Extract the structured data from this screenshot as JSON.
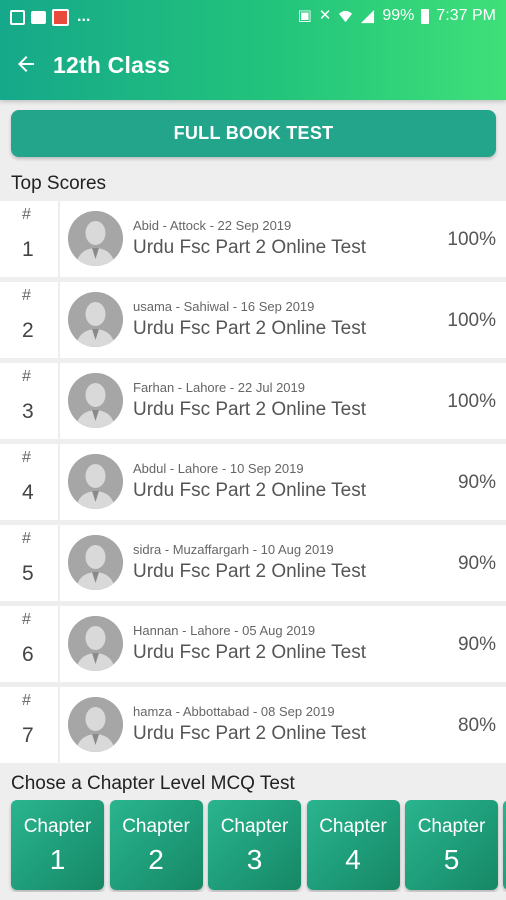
{
  "status_bar": {
    "battery": "99%",
    "time": "7:37 PM",
    "overflow": "..."
  },
  "app_bar": {
    "title": "12th Class"
  },
  "full_book_test": {
    "label": "FULL BOOK TEST"
  },
  "top_scores": {
    "title": "Top Scores",
    "hash": "#",
    "rows": [
      {
        "rank": "1",
        "meta": "Abid - Attock - 22 Sep 2019",
        "test": "Urdu Fsc Part 2 Online Test",
        "score": "100%"
      },
      {
        "rank": "2",
        "meta": "usama - Sahiwal - 16 Sep 2019",
        "test": "Urdu Fsc Part 2 Online Test",
        "score": "100%"
      },
      {
        "rank": "3",
        "meta": "Farhan - Lahore - 22 Jul 2019",
        "test": "Urdu Fsc Part 2 Online Test",
        "score": "100%"
      },
      {
        "rank": "4",
        "meta": "Abdul - Lahore - 10 Sep 2019",
        "test": "Urdu Fsc Part 2 Online Test",
        "score": "90%"
      },
      {
        "rank": "5",
        "meta": "sidra - Muzaffargarh - 10 Aug 2019",
        "test": "Urdu Fsc Part 2 Online Test",
        "score": "90%"
      },
      {
        "rank": "6",
        "meta": "Hannan - Lahore - 05 Aug 2019",
        "test": "Urdu Fsc Part 2 Online Test",
        "score": "90%"
      },
      {
        "rank": "7",
        "meta": "hamza - Abbottabad - 08 Sep 2019",
        "test": "Urdu Fsc Part 2 Online Test",
        "score": "80%"
      }
    ]
  },
  "chapters": {
    "title": "Chose a Chapter Level MCQ Test",
    "label": "Chapter",
    "items": [
      "1",
      "2",
      "3",
      "4",
      "5"
    ]
  },
  "icons": {
    "back": "arrow-left-icon",
    "avatar": "user-silhouette-icon"
  }
}
